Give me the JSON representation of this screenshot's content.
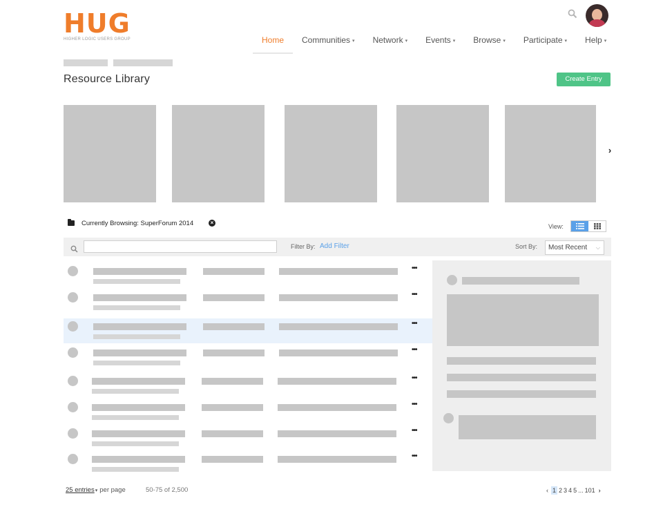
{
  "logo": {
    "main": "HUG",
    "sub": "HIGHER LOGIC USERS GROUP"
  },
  "colors": {
    "brand_orange": "#ef7d2b",
    "create_green": "#4fc487",
    "accent_blue": "#5aa0e8",
    "highlight_row": "#e9f2fc"
  },
  "header": {
    "search_icon": "search-icon",
    "avatar": "user-avatar"
  },
  "nav": {
    "items": [
      {
        "label": "Home",
        "active": true,
        "dropdown": false
      },
      {
        "label": "Communities",
        "dropdown": true
      },
      {
        "label": "Network",
        "dropdown": true
      },
      {
        "label": "Events",
        "dropdown": true
      },
      {
        "label": "Browse",
        "dropdown": true
      },
      {
        "label": "Participate",
        "dropdown": true
      },
      {
        "label": "Help",
        "dropdown": true
      }
    ],
    "caret": "▾"
  },
  "page": {
    "title": "Resource Library",
    "create_label": "Create Entry"
  },
  "carousel": {
    "next_icon": "›"
  },
  "browsing": {
    "text": "Currently Browsing: SuperForum 2014",
    "clear_icon": "×"
  },
  "view": {
    "label": "View:",
    "modes": [
      "list",
      "grid"
    ],
    "active": "list"
  },
  "filter": {
    "search_value": "",
    "filter_by_label": "Filter By:",
    "add_filter_label": "Add Filter",
    "sort_by_label": "Sort By:",
    "sort_value": "Most Recent",
    "sort_chevron": "⌵"
  },
  "list": {
    "more_icon": "•••",
    "highlighted_row": 3
  },
  "footer": {
    "entries_label": "25 entries",
    "entries_caret": "▾",
    "per_page_label": "per page",
    "range_label": "50-75  of  2,500",
    "pager_prev": "‹",
    "pages": [
      "1",
      "2",
      "3",
      "4",
      "5",
      "...",
      "101"
    ],
    "current_page": "1",
    "pager_next": "›"
  }
}
